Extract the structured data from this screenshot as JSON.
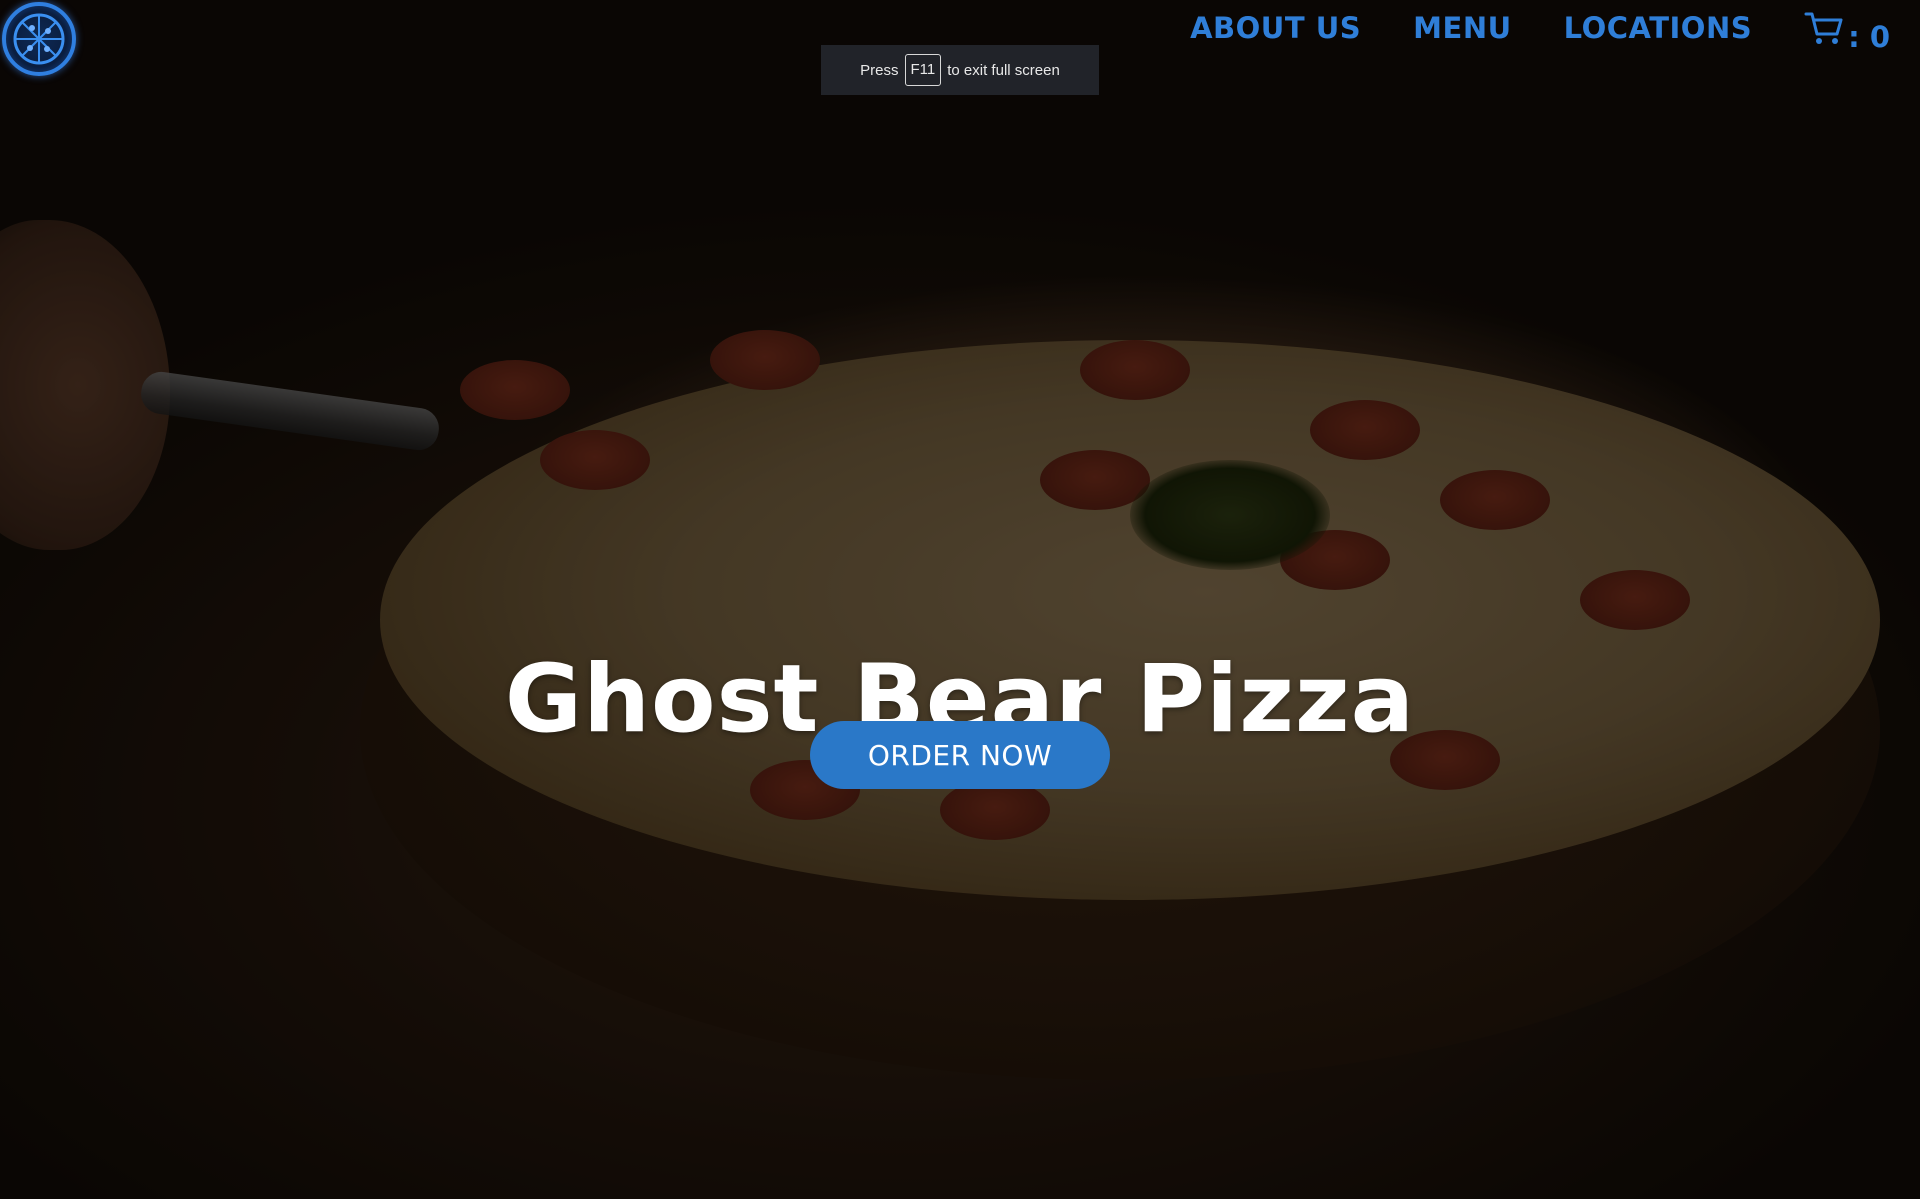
{
  "nav": {
    "logo_icon": "pizza-logo-icon",
    "links": [
      {
        "label": "ABOUT US"
      },
      {
        "label": "MENU"
      },
      {
        "label": "LOCATIONS"
      }
    ],
    "cart": {
      "icon": "shopping-cart-icon",
      "count_label": ": 0"
    }
  },
  "fullscreen_notice": {
    "prefix": "Press",
    "key": "F11",
    "suffix": "to exit full screen"
  },
  "hero": {
    "title": "Ghost Bear Pizza",
    "cta_label": "ORDER NOW"
  },
  "colors": {
    "accent": "#2f7ed8",
    "button": "#2a78c8",
    "title": "#ffffff"
  }
}
